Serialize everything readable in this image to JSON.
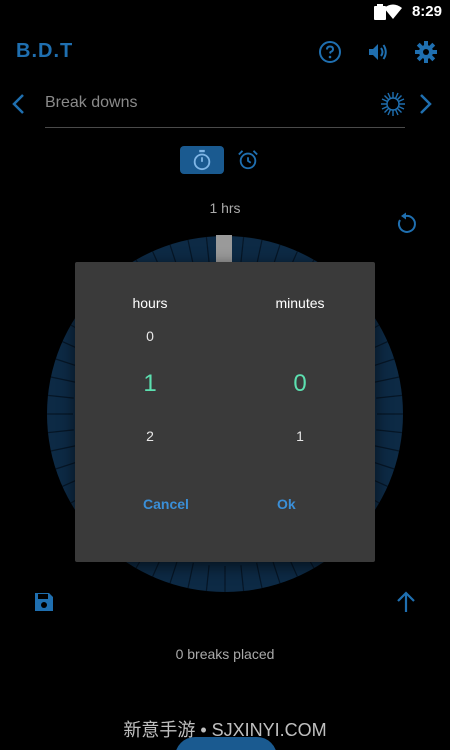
{
  "status_bar": {
    "time": "8:29"
  },
  "app_bar": {
    "title": "B.D.T"
  },
  "category": {
    "text": "Break downs"
  },
  "timer": {
    "hours_label": "1 hrs"
  },
  "dialog": {
    "hours": {
      "header": "hours",
      "prev": "0",
      "selected": "1",
      "next": "2"
    },
    "minutes": {
      "header": "minutes",
      "selected": "0",
      "next": "1"
    },
    "cancel_label": "Cancel",
    "ok_label": "Ok"
  },
  "footer": {
    "breaks_text": "0 breaks placed"
  },
  "watermark": {
    "text": "新意手游 • SJXINYI.COM"
  },
  "icons": {
    "help": "help-icon",
    "volume": "volume-icon",
    "settings": "gear-icon",
    "back": "chevron-left-icon",
    "forward": "chevron-right-icon",
    "sun": "sun-icon",
    "stopwatch": "stopwatch-icon",
    "alarm": "alarm-clock-icon",
    "reset": "reset-icon",
    "save": "save-icon",
    "upload": "upload-icon"
  },
  "colors": {
    "accent": "#1f6fb0",
    "accent_dark": "#1a5a90",
    "selected_value": "#5ce0b0",
    "dialog_bg": "#3a3a3a",
    "dialog_button": "#3a8fd8",
    "dial_fill": "#0d2a45"
  }
}
